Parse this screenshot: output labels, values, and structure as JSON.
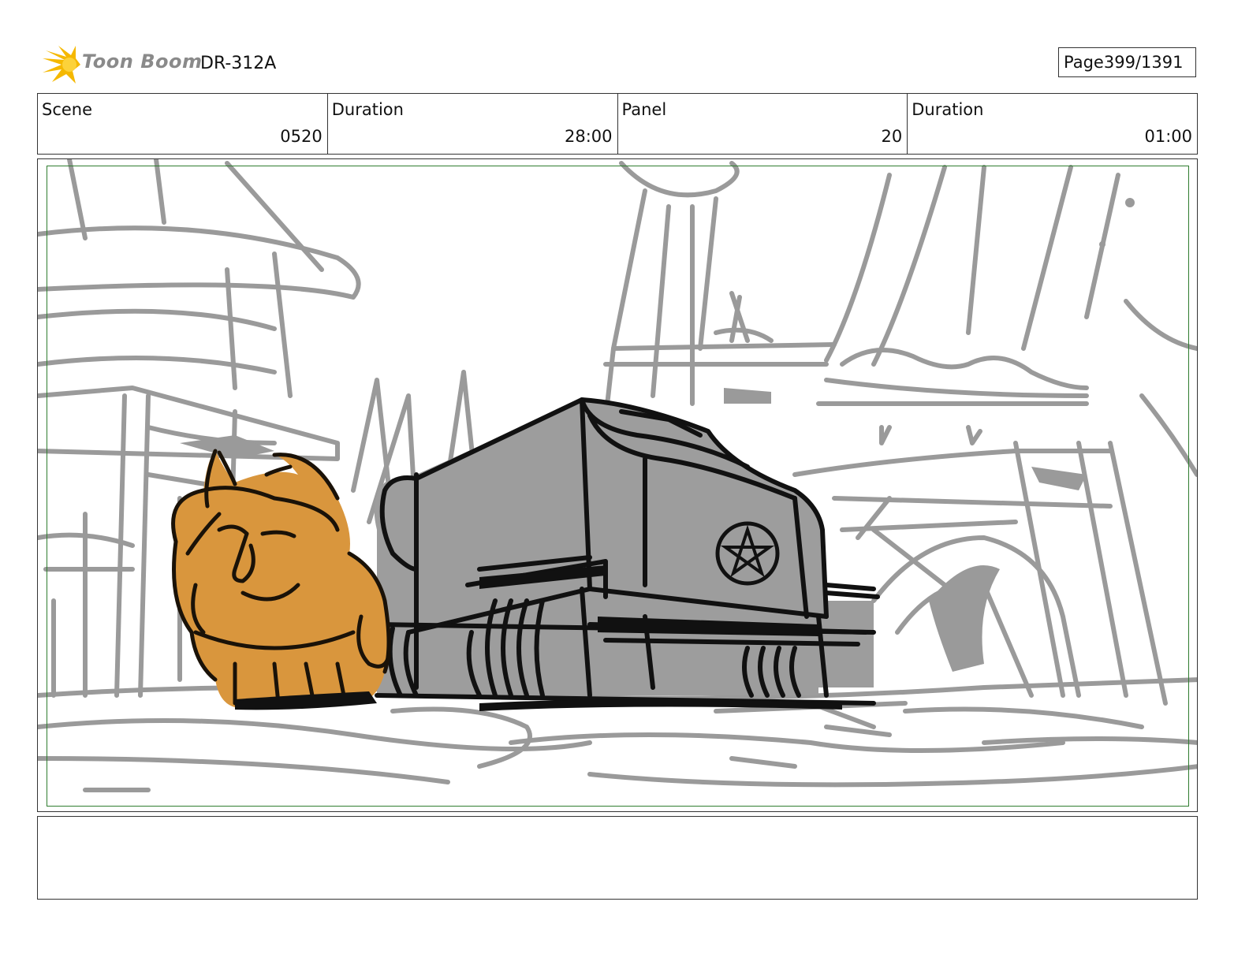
{
  "header": {
    "brand_name": "Toon Boom",
    "production_id": "DR-312A",
    "page_label": "Page",
    "page_value": "399/1391"
  },
  "info": {
    "scene_label": "Scene",
    "scene_value": "0520",
    "scene_duration_label": "Duration",
    "scene_duration_value": "28:00",
    "panel_label": "Panel",
    "panel_value": "20",
    "panel_duration_label": "Duration",
    "panel_duration_value": "01:00"
  },
  "notes": {
    "text": ""
  },
  "colors": {
    "sketch_gray": "#9a9a9a",
    "ink": "#111111",
    "box_fill": "#9d9d9d",
    "creature_fill": "#d9963d",
    "safe_frame": "#2f7d2f",
    "logo_yellow": "#f5b800"
  }
}
